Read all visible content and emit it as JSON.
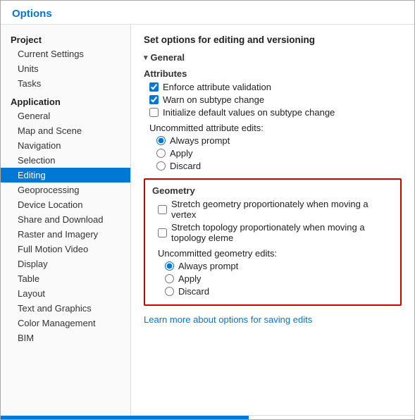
{
  "window": {
    "title": "Options"
  },
  "sidebar": {
    "sections": [
      {
        "label": "Project",
        "items": [
          "Current Settings",
          "Units",
          "Tasks"
        ]
      },
      {
        "label": "Application",
        "items": [
          "General",
          "Map and Scene",
          "Navigation",
          "Selection",
          "Editing",
          "Geoprocessing",
          "Device Location",
          "Share and Download",
          "Raster and Imagery",
          "Full Motion Video",
          "Display",
          "Table",
          "Layout",
          "Text and Graphics",
          "Color Management",
          "BIM"
        ]
      }
    ],
    "active_item": "Editing"
  },
  "panel": {
    "heading": "Set options for editing and versioning",
    "general_section": "General",
    "general_arrow": "▾",
    "attributes_label": "Attributes",
    "checkboxes": [
      {
        "label": "Enforce attribute validation",
        "checked": true
      },
      {
        "label": "Warn on subtype change",
        "checked": true
      },
      {
        "label": "Initialize default values on subtype change",
        "checked": false
      }
    ],
    "uncommitted_attributes_label": "Uncommitted attribute edits:",
    "attribute_radios": [
      {
        "label": "Always prompt",
        "selected": true
      },
      {
        "label": "Apply",
        "selected": false
      },
      {
        "label": "Discard",
        "selected": false
      }
    ],
    "geometry_label": "Geometry",
    "geometry_checkboxes": [
      {
        "label": "Stretch geometry proportionately when moving a vertex",
        "checked": false
      },
      {
        "label": "Stretch topology proportionately when moving a topology eleme",
        "checked": false
      }
    ],
    "uncommitted_geometry_label": "Uncommitted geometry edits:",
    "geometry_radios": [
      {
        "label": "Always prompt",
        "selected": true
      },
      {
        "label": "Apply",
        "selected": false
      },
      {
        "label": "Discard",
        "selected": false
      }
    ],
    "learn_more_label": "Learn more about options for saving edits"
  }
}
